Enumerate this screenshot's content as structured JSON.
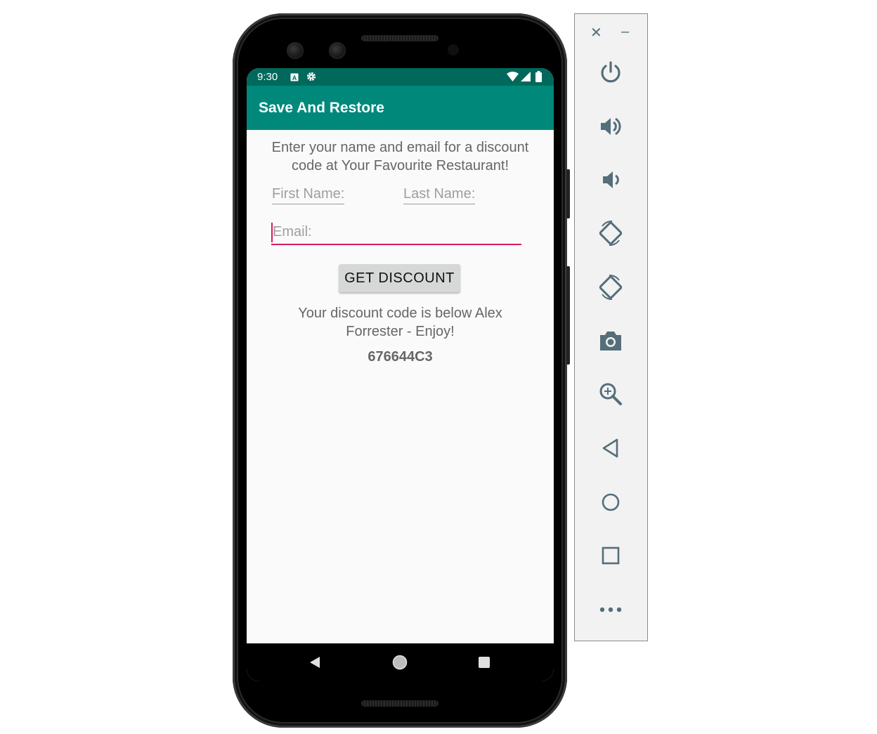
{
  "status_bar": {
    "time": "9:30",
    "icons": [
      "a-box-icon",
      "settings-icon",
      "wifi-icon",
      "signal-icon",
      "battery-icon"
    ]
  },
  "app_bar": {
    "title": "Save And Restore"
  },
  "content": {
    "intro_line1": "Enter your name and email for a discount",
    "intro_line2": "code at Your Favourite Restaurant!",
    "first_name_placeholder": "First Name:",
    "last_name_placeholder": "Last Name:",
    "email_placeholder": "Email:",
    "button_label": "GET DISCOUNT",
    "result_line1": "Your discount code is below Alex",
    "result_line2": "Forrester - Enjoy!",
    "discount_code": "676644C3"
  },
  "nav_bar": {
    "buttons": [
      "back-icon",
      "home-icon",
      "recents-icon"
    ]
  },
  "emulator_toolbar": {
    "close_label": "✕",
    "minimize_label": "–",
    "controls": [
      "power",
      "volume-up",
      "volume-down",
      "rotate-left",
      "rotate-right",
      "screenshot",
      "zoom",
      "back",
      "home",
      "overview",
      "more"
    ]
  },
  "colors": {
    "status_bar": "#00695c",
    "app_bar": "#00897b",
    "accent": "#d81b60",
    "toolbar_icon": "#546e7a"
  }
}
